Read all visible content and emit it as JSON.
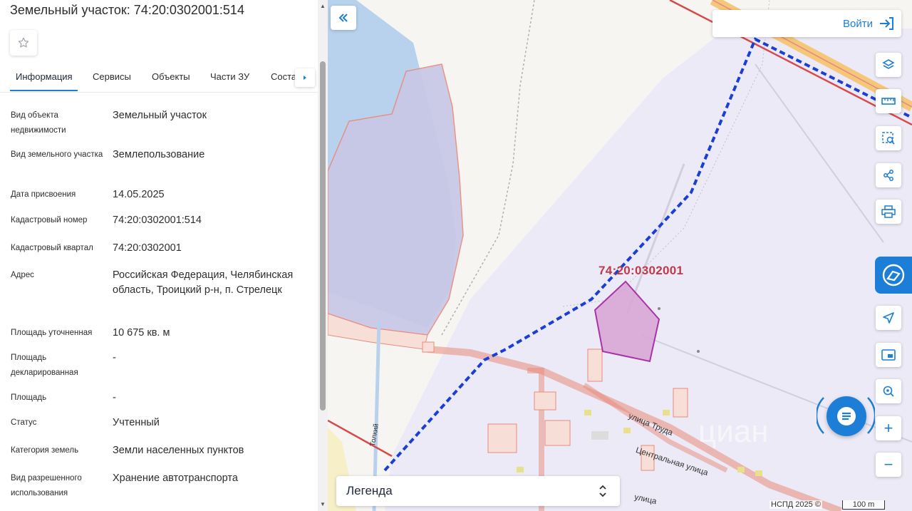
{
  "panel": {
    "title": "Земельный участок: 74:20:0302001:514",
    "favorite_icon": "star-outline-icon",
    "tabs": [
      {
        "label": "Информация",
        "active": true
      },
      {
        "label": "Сервисы"
      },
      {
        "label": "Объекты"
      },
      {
        "label": "Части ЗУ"
      },
      {
        "label": "Соста"
      }
    ],
    "tab_next_icon": "caret-right-icon",
    "rows": [
      {
        "label": "Вид объекта недвижимости",
        "value": "Земельный участок"
      },
      {
        "label": "Вид земельного участка",
        "value": "Землепользование"
      },
      {
        "label": "Дата присвоения",
        "value": "14.05.2025"
      },
      {
        "label": "Кадастровый номер",
        "value": "74:20:0302001:514"
      },
      {
        "label": "Кадастровый квартал",
        "value": "74:20:0302001"
      },
      {
        "label": "Адрес",
        "value": "Российская Федерация, Челябинская область, Троицкий р-н, п. Стрелецк"
      },
      {
        "label": "Площадь уточненная",
        "value": "10 675 кв. м"
      },
      {
        "label": "Площадь декларированная",
        "value": "-"
      },
      {
        "label": "Площадь",
        "value": "-"
      },
      {
        "label": "Статус",
        "value": "Учтенный"
      },
      {
        "label": "Категория земель",
        "value": "Земли населенных пунктов"
      },
      {
        "label": "Вид разрешенного использования",
        "value": "Хранение автотранспорта"
      }
    ]
  },
  "map": {
    "collapse_icon": "double-chevron-left-icon",
    "login_label": "Войти",
    "login_icon": "login-icon",
    "quarter_label": "74:20:0302001",
    "streets": [
      "улица Труда",
      "Центральная улица",
      "Толкий",
      "улица"
    ],
    "tools": [
      {
        "name": "layers-icon"
      },
      {
        "name": "ruler-icon"
      },
      {
        "name": "area-select-icon"
      },
      {
        "name": "share-icon"
      },
      {
        "name": "print-icon"
      },
      {
        "name": "nspd-logo-icon"
      },
      {
        "name": "navigation-icon"
      },
      {
        "name": "minimap-icon"
      },
      {
        "name": "location-search-icon"
      },
      {
        "name": "zoom-in-icon"
      },
      {
        "name": "zoom-out-icon"
      }
    ],
    "zoom_in": "+",
    "zoom_out": "−",
    "legend_label": "Легенда",
    "attribution": "НСПД 2025 ©",
    "scale_label": "100 m",
    "watermark": "циан"
  },
  "colors": {
    "accent": "#1c7ed6",
    "parcel_fill": "#d9a8d6",
    "parcel_stroke": "#a020a0",
    "quarter_label": "#c0394b",
    "boundary_dashed": "#1a3fd6",
    "water": "#b8d2ee",
    "settlement": "#eceaf6"
  }
}
